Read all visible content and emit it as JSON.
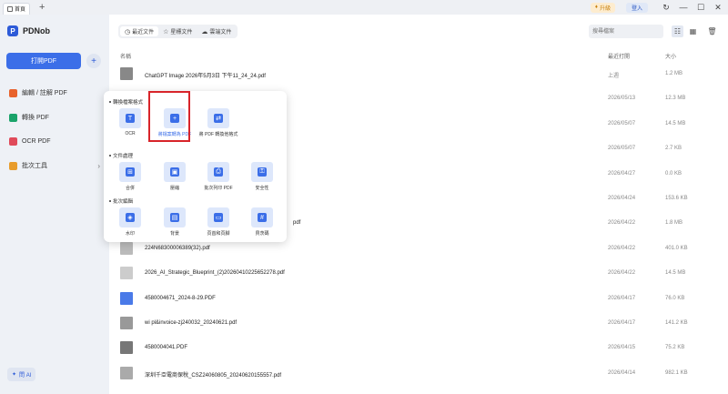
{
  "titlebar": {
    "tab_label": "首頁",
    "tab_add": "+",
    "upgrade_label": "升級",
    "login_label": "登入",
    "icons": [
      "refresh-icon",
      "minimize-icon",
      "maximize-icon",
      "close-icon"
    ],
    "icon_glyphs": [
      "↻",
      "—",
      "☐",
      "✕"
    ]
  },
  "sidebar": {
    "logo": "PDNob",
    "open_button": "打開PDF",
    "plus": "+",
    "items": [
      {
        "label": "編輯 / 註解 PDF",
        "color": "#e8622c"
      },
      {
        "label": "轉換 PDF",
        "color": "#1aa36a"
      },
      {
        "label": "OCR PDF",
        "color": "#e04a5a"
      },
      {
        "label": "批次工具",
        "color": "#e89c2c"
      }
    ],
    "ai_label": "問 AI"
  },
  "main": {
    "tabs": [
      {
        "label": "最近文件",
        "icon": "◷"
      },
      {
        "label": "星標文件",
        "icon": "☆"
      },
      {
        "label": "雲端文件",
        "icon": "☁"
      }
    ],
    "search_placeholder": "搜尋檔案",
    "columns": {
      "name": "名稱",
      "date": "最近打開",
      "size": "大小"
    },
    "rows": [
      {
        "name": "ChatGPT Image 2026年5月3日 下午11_24_24.pdf",
        "date": "上週",
        "size": "1.2 MB",
        "thumb": "#888"
      },
      {
        "name": "",
        "date": "2026/05/13",
        "size": "12.3 MB",
        "thumb": "#bbb"
      },
      {
        "name": "",
        "date": "2026/05/07",
        "size": "14.5 MB",
        "thumb": "#bbb"
      },
      {
        "name": "",
        "date": "2026/05/07",
        "size": "2.7 KB",
        "thumb": "#bbb"
      },
      {
        "name": "",
        "date": "2026/04/27",
        "size": "0.0 KB",
        "thumb": "#bbb"
      },
      {
        "name": "",
        "date": "2026/04/24",
        "size": "153.6 KB",
        "thumb": "#bbb"
      },
      {
        "name": "pdf",
        "date": "2026/04/22",
        "size": "1.8 MB",
        "thumb": "#bbb"
      },
      {
        "name": "224N68300006389(32).pdf",
        "date": "2026/04/22",
        "size": "401.0 KB",
        "thumb": "#bbb"
      },
      {
        "name": "2026_AI_Strategic_Blueprint_(2)20260410225652278.pdf",
        "date": "2026/04/22",
        "size": "14.5 MB",
        "thumb": "#ccc"
      },
      {
        "name": "4580004671_2024-8-29.PDF",
        "date": "2026/04/17",
        "size": "76.0 KB",
        "thumb": "#4a7ae8"
      },
      {
        "name": "wi pl&invoice-zj240032_20240621.pdf",
        "date": "2026/04/17",
        "size": "141.2 KB",
        "thumb": "#999"
      },
      {
        "name": "4580004041.PDF",
        "date": "2026/04/15",
        "size": "75.2 KB",
        "thumb": "#777"
      },
      {
        "name": "深圳千亞電商保稅_CSZ24060805_20240620155557.pdf",
        "date": "2026/04/14",
        "size": "982.1 KB",
        "thumb": "#aaa"
      }
    ]
  },
  "popup": {
    "sections": [
      {
        "title": "轉換檔案格式",
        "tools": [
          {
            "label": "OCR",
            "glyph": "T",
            "selected": false
          },
          {
            "label": "將檔案轉為 PDF",
            "glyph": "+",
            "selected": true
          },
          {
            "label": "將 PDF 轉換他格式",
            "glyph": "⇄",
            "selected": false
          }
        ]
      },
      {
        "title": "文件處理",
        "tools": [
          {
            "label": "合併",
            "glyph": "⊞",
            "selected": false
          },
          {
            "label": "壓縮",
            "glyph": "▣",
            "selected": false
          },
          {
            "label": "批次列印 PDF",
            "glyph": "⎙",
            "selected": false
          },
          {
            "label": "安全性",
            "glyph": "⚿",
            "selected": false
          }
        ]
      },
      {
        "title": "批次編輯",
        "tools": [
          {
            "label": "水印",
            "glyph": "◈",
            "selected": false
          },
          {
            "label": "背景",
            "glyph": "▤",
            "selected": false
          },
          {
            "label": "頁首和頁腳",
            "glyph": "▭",
            "selected": false
          },
          {
            "label": "貝茨碼",
            "glyph": "#",
            "selected": false
          }
        ]
      }
    ]
  }
}
